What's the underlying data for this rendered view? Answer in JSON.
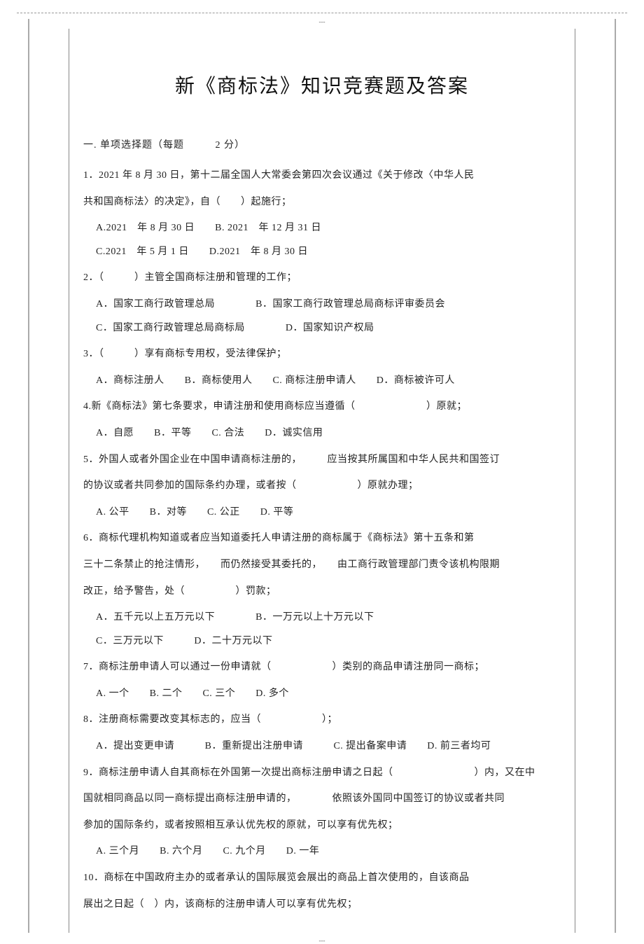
{
  "top_mark": "---",
  "bottom_mark": "---",
  "title": "新《商标法》知识竞赛题及答案",
  "section": {
    "number": "一.",
    "label": "单项选择题（每题",
    "points": "2 分）"
  },
  "questions": [
    {
      "num": "1．",
      "text_parts": [
        "2021 年 8 月 30 日，第十二届全国人大常委会第四次会议通过《关于修改〈中华人民",
        "共和国商标法〉的决定》，自（　　）起施行；"
      ],
      "option_lines": [
        "A.2021　年 8 月 30 日　　B. 2021　年 12 月 31 日",
        "C.2021　年 5 月 1 日　　D.2021　年 8 月 30 日"
      ]
    },
    {
      "num": "2．",
      "text_parts": [
        "（　　　）主管全国商标注册和管理的工作；"
      ],
      "option_lines": [
        "A．国家工商行政管理总局　　　　B．国家工商行政管理总局商标评审委员会",
        "C．国家工商行政管理总局商标局　　　　D．国家知识产权局"
      ]
    },
    {
      "num": "3．",
      "text_parts": [
        "（　　　）享有商标专用权，受法律保护；"
      ],
      "option_lines": [
        "A．商标注册人　　B．商标使用人　　C. 商标注册申请人　　D．商标被许可人"
      ]
    },
    {
      "num": "4.",
      "text_parts": [
        "新《商标法》第七条要求，申请注册和使用商标应当遵循（　　　　　　　）原就；"
      ],
      "option_lines": [
        "A．自愿　　B．平等　　C. 合法　　D．诚实信用"
      ]
    },
    {
      "num": "5．",
      "text_parts": [
        "外国人或者外国企业在中国申请商标注册的，　　　应当按其所属国和中华人民共和国签订",
        "的协议或者共同参加的国际条约办理，或者按（　　　　　　）原就办理；"
      ],
      "option_lines": [
        "A. 公平　　B．对等　　C. 公正　　D. 平等"
      ]
    },
    {
      "num": "6．",
      "text_parts": [
        "商标代理机构知道或者应当知道委托人申请注册的商标属于《商标法》第十五条和第",
        "三十二条禁止的抢注情形，　　而仍然接受其委托的，　　由工商行政管理部门责令该机构限期",
        "改正，给予警告，处（　　　　　）罚款；"
      ],
      "option_lines": [
        "A．五千元以上五万元以下　　　　B．一万元以上十万元以下",
        "C．三万元以下　　　D．二十万元以下"
      ]
    },
    {
      "num": "7．",
      "text_parts": [
        "商标注册申请人可以通过一份申请就（　　　　　　）类别的商品申请注册同一商标；"
      ],
      "option_lines": [
        "A. 一个　　B. 二个　　C. 三个　　D. 多个"
      ]
    },
    {
      "num": "8．",
      "text_parts": [
        "注册商标需要改变其标志的，应当（　　　　　　）；"
      ],
      "option_lines": [
        "A．提出变更申请　　　B．重新提出注册申请　　　C. 提出备案申请　　D. 前三者均可"
      ]
    },
    {
      "num": "9．",
      "text_parts": [
        "商标注册申请人自其商标在外国第一次提出商标注册申请之日起（　　　　　　　　）内，又在中",
        "国就相同商品以同一商标提出商标注册申请的，　　　　依照该外国同中国签订的协议或者共同",
        "参加的国际条约，或者按照相互承认优先权的原就，可以享有优先权；"
      ],
      "option_lines": [
        "A. 三个月　　B. 六个月　　C. 九个月　　D. 一年"
      ]
    },
    {
      "num": "10．",
      "text_parts": [
        "商标在中国政府主办的或者承认的国际展览会展出的商品上首次使用的，自该商品",
        "展出之日起（　）内，该商标的注册申请人可以享有优先权；"
      ],
      "option_lines": []
    }
  ]
}
